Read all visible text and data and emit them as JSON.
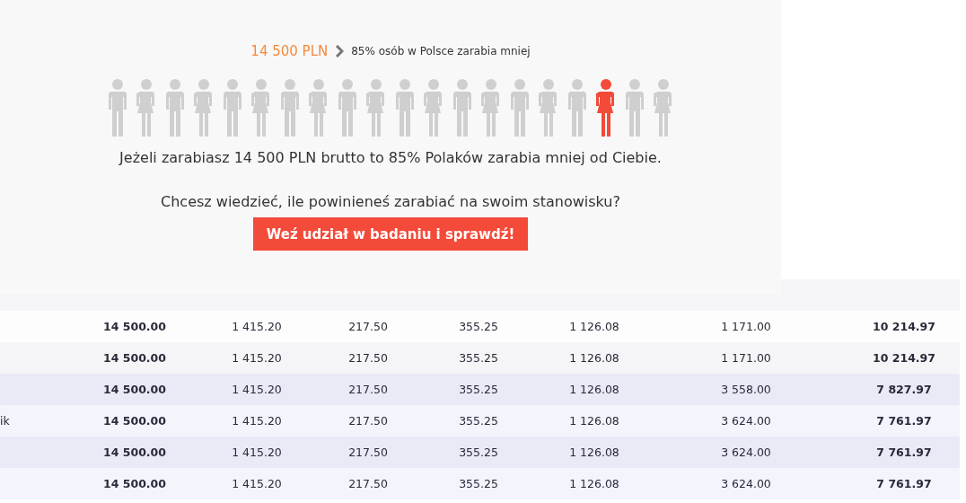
{
  "popup": {
    "amount": "14 500 PLN",
    "summary": "85% osób w Polsce zarabia mniej",
    "figures": [
      {
        "kind": "man",
        "selected": false
      },
      {
        "kind": "woman",
        "selected": false
      },
      {
        "kind": "man",
        "selected": false
      },
      {
        "kind": "woman",
        "selected": false
      },
      {
        "kind": "man",
        "selected": false
      },
      {
        "kind": "woman",
        "selected": false
      },
      {
        "kind": "man",
        "selected": false
      },
      {
        "kind": "woman",
        "selected": false
      },
      {
        "kind": "man",
        "selected": false
      },
      {
        "kind": "woman",
        "selected": false
      },
      {
        "kind": "man",
        "selected": false
      },
      {
        "kind": "woman",
        "selected": false
      },
      {
        "kind": "man",
        "selected": false
      },
      {
        "kind": "woman",
        "selected": false
      },
      {
        "kind": "man",
        "selected": false
      },
      {
        "kind": "woman",
        "selected": false
      },
      {
        "kind": "man",
        "selected": false
      },
      {
        "kind": "woman",
        "selected": true
      },
      {
        "kind": "man",
        "selected": false
      },
      {
        "kind": "woman",
        "selected": false
      }
    ],
    "sentence": "Jeżeli zarabiasz 14 500 PLN brutto to 85% Polaków zarabia mniej od Ciebie.",
    "question": "Chcesz wiedzieć, ile powinieneś zarabiać na swoim stanowisku?",
    "button": "Weź udział w badaniu i sprawdź!"
  },
  "table": {
    "rows": [
      {
        "kind": "plain",
        "cells": [
          "",
          "14 500.00",
          "1 415.20",
          "217.50",
          "355.25",
          "1 126.08",
          "1 171.00",
          "10 214.97"
        ]
      },
      {
        "kind": "plain",
        "cells": [
          "",
          "14 500.00",
          "1 415.20",
          "217.50",
          "355.25",
          "1 126.08",
          "1 171.00",
          "10 214.97"
        ]
      },
      {
        "kind": "tinted",
        "cells": [
          "",
          "14 500.00",
          "1 415.20",
          "217.50",
          "355.25",
          "1 126.08",
          "3 558.00",
          "7 827.97"
        ]
      },
      {
        "kind": "tinted",
        "cells": [
          "ik",
          "14 500.00",
          "1 415.20",
          "217.50",
          "355.25",
          "1 126.08",
          "3 624.00",
          "7 761.97"
        ]
      },
      {
        "kind": "tinted",
        "cells": [
          "",
          "14 500.00",
          "1 415.20",
          "217.50",
          "355.25",
          "1 126.08",
          "3 624.00",
          "7 761.97"
        ]
      },
      {
        "kind": "tinted",
        "cells": [
          "",
          "14 500.00",
          "1 415.20",
          "217.50",
          "355.25",
          "1 126.08",
          "3 624.00",
          "7 761.97"
        ]
      }
    ]
  }
}
